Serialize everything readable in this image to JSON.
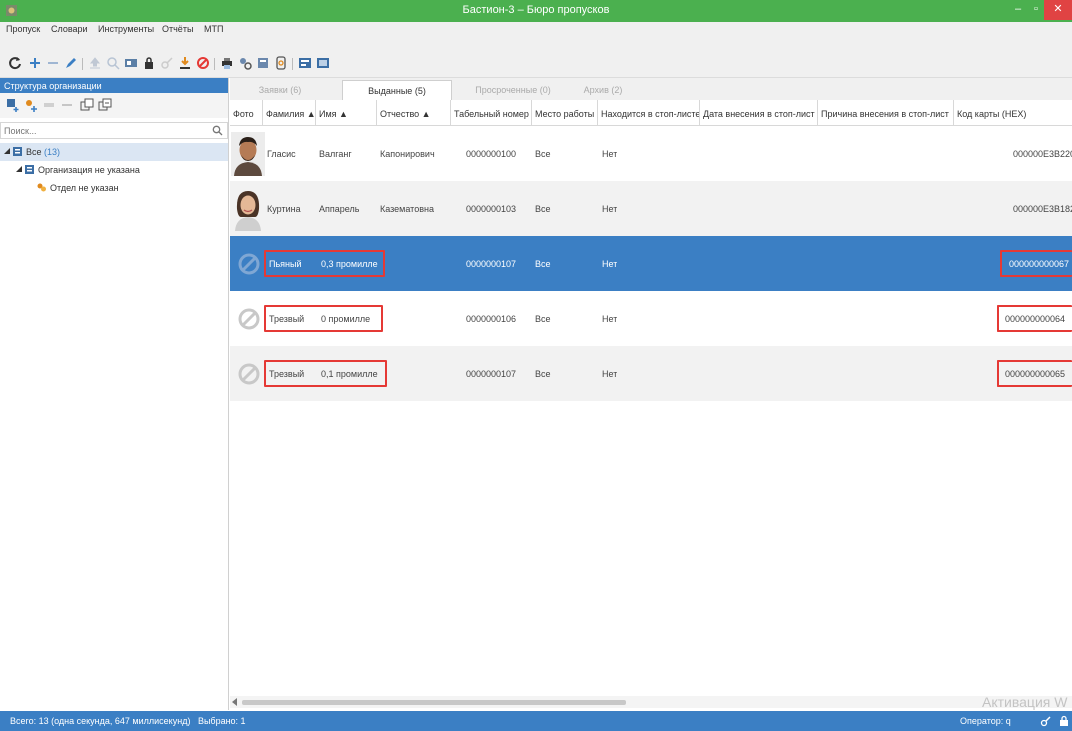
{
  "window": {
    "title": "Бастион-3 – Бюро пропусков"
  },
  "menu": [
    "Пропуск",
    "Словари",
    "Инструменты",
    "Отчёты",
    "МТП"
  ],
  "toolbar_icons": [
    "refresh-icon",
    "add-icon",
    "remove-icon",
    "edit-icon",
    "upload-icon",
    "zoom-in-icon",
    "card-icon",
    "lock-icon",
    "key-icon",
    "download-icon",
    "block-icon",
    "print-icon",
    "users-search-icon",
    "report-icon",
    "fingerprint-icon",
    "cards-list-icon",
    "cards-export-icon"
  ],
  "sidebar": {
    "header": "Структура организации",
    "search_placeholder": "Поиск...",
    "tree": [
      {
        "label": "Все",
        "count": "(13)"
      },
      {
        "label": "Организация не указана"
      },
      {
        "label": "Отдел не указан"
      }
    ]
  },
  "tabs": [
    {
      "label": "Заявки (6)",
      "active": false
    },
    {
      "label": "Выданные (5)",
      "active": true
    },
    {
      "label": "Просроченные (0)",
      "active": false
    },
    {
      "label": "Архив (2)",
      "active": false
    }
  ],
  "columns": [
    "Фото",
    "Фамилия ▲",
    "Имя ▲",
    "Отчество ▲",
    "Табельный номер",
    "Место работы",
    "Находится в стоп-листе",
    "Дата внесения в стоп-лист",
    "Причина внесения в стоп-лист",
    "Код карты (HEX)"
  ],
  "rows": [
    {
      "photo": "man-photo",
      "surname": "Гласис",
      "name": "Валганг",
      "patronymic": "Капонирович",
      "tab_no": "0000000100",
      "workplace": "Все",
      "stoplist": "Нет",
      "card": "000000E3B220"
    },
    {
      "photo": "woman-photo",
      "surname": "Куртина",
      "name": "Аппарель",
      "patronymic": "Казематовна",
      "tab_no": "0000000103",
      "workplace": "Все",
      "stoplist": "Нет",
      "card": "000000E3B182"
    },
    {
      "photo": "no-photo",
      "surname": "Пьяный",
      "name": "0,3 промилле",
      "patronymic": "",
      "tab_no": "0000000107",
      "workplace": "Все",
      "stoplist": "Нет",
      "card": "000000000067"
    },
    {
      "photo": "no-photo",
      "surname": "Трезвый",
      "name": "0 промилле",
      "patronymic": "",
      "tab_no": "0000000106",
      "workplace": "Все",
      "stoplist": "Нет",
      "card": "000000000064"
    },
    {
      "photo": "no-photo",
      "surname": "Трезвый",
      "name": "0,1 промилле",
      "patronymic": "",
      "tab_no": "0000000107",
      "workplace": "Все",
      "stoplist": "Нет",
      "card": "000000000065"
    }
  ],
  "selected_row": 2,
  "watermark": "Активация W",
  "status": {
    "left": "Всего: 13 (одна секунда, 647 миллисекунд)   Выбрано: 1",
    "operator": "Оператор: q"
  },
  "colors": {
    "titlebar": "#4bb04f",
    "accent": "#3b7fc4",
    "highlight": "#e53935",
    "close": "#e04343"
  }
}
